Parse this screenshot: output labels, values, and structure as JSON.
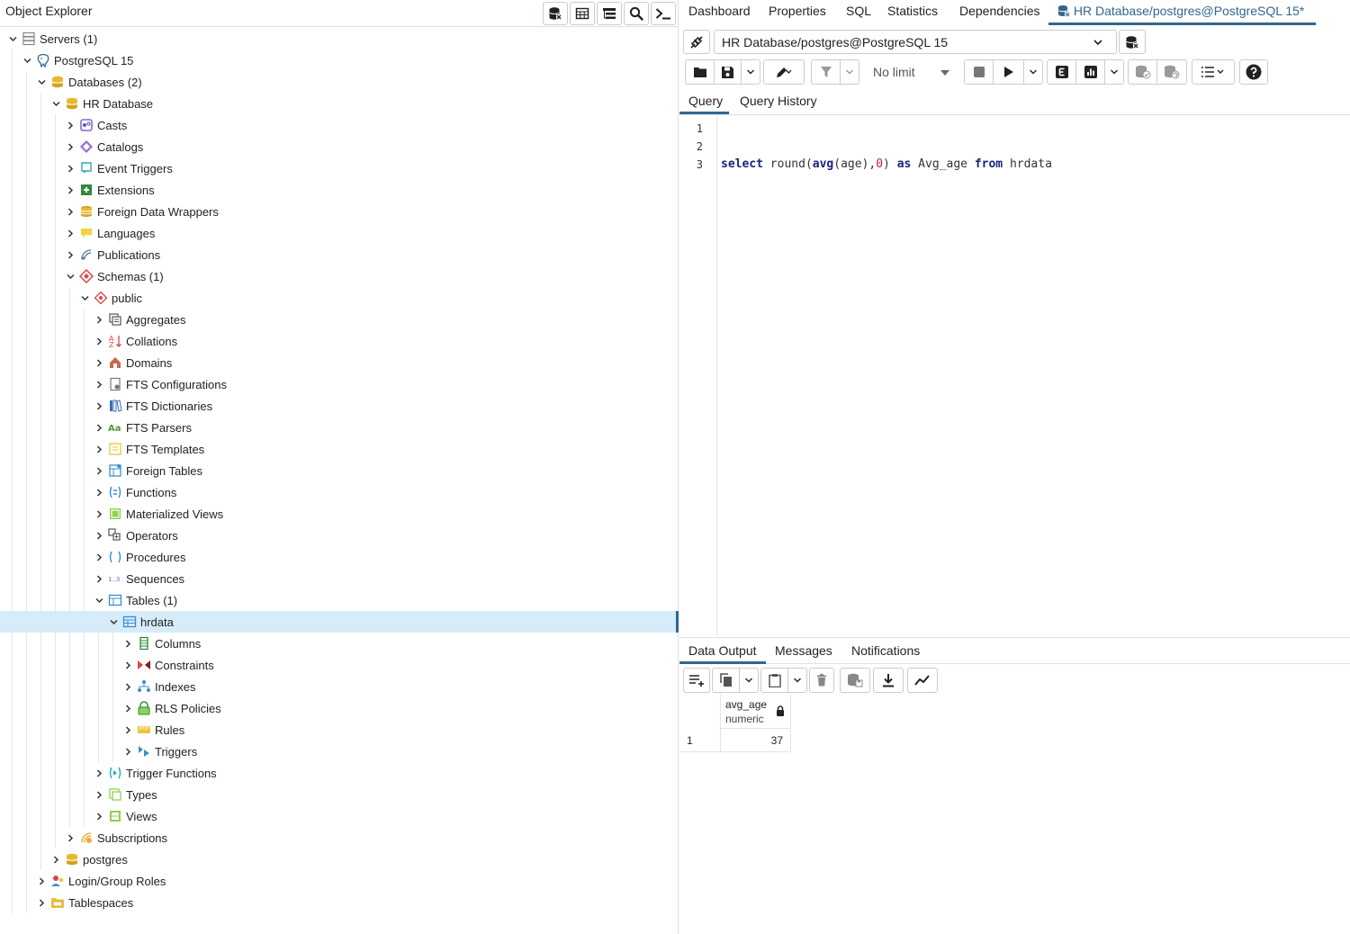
{
  "object_explorer": {
    "title": "Object Explorer",
    "tools": [
      "database-icon",
      "table-icon",
      "tree-query-icon",
      "search-icon",
      "terminal-icon"
    ],
    "tree": [
      {
        "label": "Servers (1)",
        "level": 0,
        "expanded": true,
        "icon": "servers-icon"
      },
      {
        "label": "PostgreSQL 15",
        "level": 1,
        "expanded": true,
        "icon": "postgres-elephant-icon"
      },
      {
        "label": "Databases (2)",
        "level": 2,
        "expanded": true,
        "icon": "databases-icon"
      },
      {
        "label": "HR Database",
        "level": 3,
        "expanded": true,
        "icon": "database-icon"
      },
      {
        "label": "Casts",
        "level": 4,
        "expanded": false,
        "icon": "casts-icon"
      },
      {
        "label": "Catalogs",
        "level": 4,
        "expanded": false,
        "icon": "catalogs-icon"
      },
      {
        "label": "Event Triggers",
        "level": 4,
        "expanded": false,
        "icon": "event-triggers-icon"
      },
      {
        "label": "Extensions",
        "level": 4,
        "expanded": false,
        "icon": "extensions-icon"
      },
      {
        "label": "Foreign Data Wrappers",
        "level": 4,
        "expanded": false,
        "icon": "foreign-data-wrappers-icon"
      },
      {
        "label": "Languages",
        "level": 4,
        "expanded": false,
        "icon": "languages-icon"
      },
      {
        "label": "Publications",
        "level": 4,
        "expanded": false,
        "icon": "publications-icon"
      },
      {
        "label": "Schemas (1)",
        "level": 4,
        "expanded": true,
        "icon": "schemas-icon"
      },
      {
        "label": "public",
        "level": 5,
        "expanded": true,
        "icon": "schema-icon"
      },
      {
        "label": "Aggregates",
        "level": 6,
        "expanded": false,
        "icon": "aggregates-icon"
      },
      {
        "label": "Collations",
        "level": 6,
        "expanded": false,
        "icon": "collations-icon"
      },
      {
        "label": "Domains",
        "level": 6,
        "expanded": false,
        "icon": "domains-icon"
      },
      {
        "label": "FTS Configurations",
        "level": 6,
        "expanded": false,
        "icon": "fts-configurations-icon"
      },
      {
        "label": "FTS Dictionaries",
        "level": 6,
        "expanded": false,
        "icon": "fts-dictionaries-icon"
      },
      {
        "label": "FTS Parsers",
        "level": 6,
        "expanded": false,
        "icon": "fts-parsers-icon"
      },
      {
        "label": "FTS Templates",
        "level": 6,
        "expanded": false,
        "icon": "fts-templates-icon"
      },
      {
        "label": "Foreign Tables",
        "level": 6,
        "expanded": false,
        "icon": "foreign-tables-icon"
      },
      {
        "label": "Functions",
        "level": 6,
        "expanded": false,
        "icon": "functions-icon"
      },
      {
        "label": "Materialized Views",
        "level": 6,
        "expanded": false,
        "icon": "materialized-views-icon"
      },
      {
        "label": "Operators",
        "level": 6,
        "expanded": false,
        "icon": "operators-icon"
      },
      {
        "label": "Procedures",
        "level": 6,
        "expanded": false,
        "icon": "procedures-icon"
      },
      {
        "label": "Sequences",
        "level": 6,
        "expanded": false,
        "icon": "sequences-icon"
      },
      {
        "label": "Tables (1)",
        "level": 6,
        "expanded": true,
        "icon": "tables-icon"
      },
      {
        "label": "hrdata",
        "level": 7,
        "expanded": true,
        "icon": "table-icon",
        "selected": true
      },
      {
        "label": "Columns",
        "level": 8,
        "expanded": false,
        "icon": "columns-icon"
      },
      {
        "label": "Constraints",
        "level": 8,
        "expanded": false,
        "icon": "constraints-icon"
      },
      {
        "label": "Indexes",
        "level": 8,
        "expanded": false,
        "icon": "indexes-icon"
      },
      {
        "label": "RLS Policies",
        "level": 8,
        "expanded": false,
        "icon": "rls-policies-icon"
      },
      {
        "label": "Rules",
        "level": 8,
        "expanded": false,
        "icon": "rules-icon"
      },
      {
        "label": "Triggers",
        "level": 8,
        "expanded": false,
        "icon": "triggers-icon"
      },
      {
        "label": "Trigger Functions",
        "level": 6,
        "expanded": false,
        "icon": "trigger-functions-icon"
      },
      {
        "label": "Types",
        "level": 6,
        "expanded": false,
        "icon": "types-icon"
      },
      {
        "label": "Views",
        "level": 6,
        "expanded": false,
        "icon": "views-icon"
      },
      {
        "label": "Subscriptions",
        "level": 4,
        "expanded": false,
        "icon": "subscriptions-icon"
      },
      {
        "label": "postgres",
        "level": 3,
        "expanded": false,
        "icon": "database-icon"
      },
      {
        "label": "Login/Group Roles",
        "level": 2,
        "expanded": false,
        "icon": "login-roles-icon"
      },
      {
        "label": "Tablespaces",
        "level": 2,
        "expanded": false,
        "icon": "tablespaces-icon"
      }
    ]
  },
  "main_tabs": [
    {
      "label": "Dashboard"
    },
    {
      "label": "Properties"
    },
    {
      "label": "SQL"
    },
    {
      "label": "Statistics"
    },
    {
      "label": "Dependencies"
    },
    {
      "label": "HR Database/postgres@PostgreSQL 15*",
      "active": true
    }
  ],
  "connection": {
    "selected": "HR Database/postgres@PostgreSQL 15"
  },
  "toolbar": {
    "limit": "No limit"
  },
  "query_tabs": [
    "Query",
    "Query History"
  ],
  "editor": {
    "line_numbers": [
      "1",
      "2",
      "3"
    ],
    "code": {
      "t1": "select",
      "t2": " round",
      "t3": "(",
      "t4": "avg",
      "t5": "(age),",
      "t6": "0",
      "t7": ") ",
      "t8": "as",
      "t9": " Avg_age ",
      "t10": "from",
      "t11": " hrdata"
    }
  },
  "output_tabs": [
    "Data Output",
    "Messages",
    "Notifications"
  ],
  "result": {
    "column_name": "avg_age",
    "column_type": "numeric",
    "rows": [
      {
        "num": "1",
        "value": "37"
      }
    ]
  },
  "colors": {
    "accent": "#326690",
    "selected_row": "#d6ecf9"
  }
}
